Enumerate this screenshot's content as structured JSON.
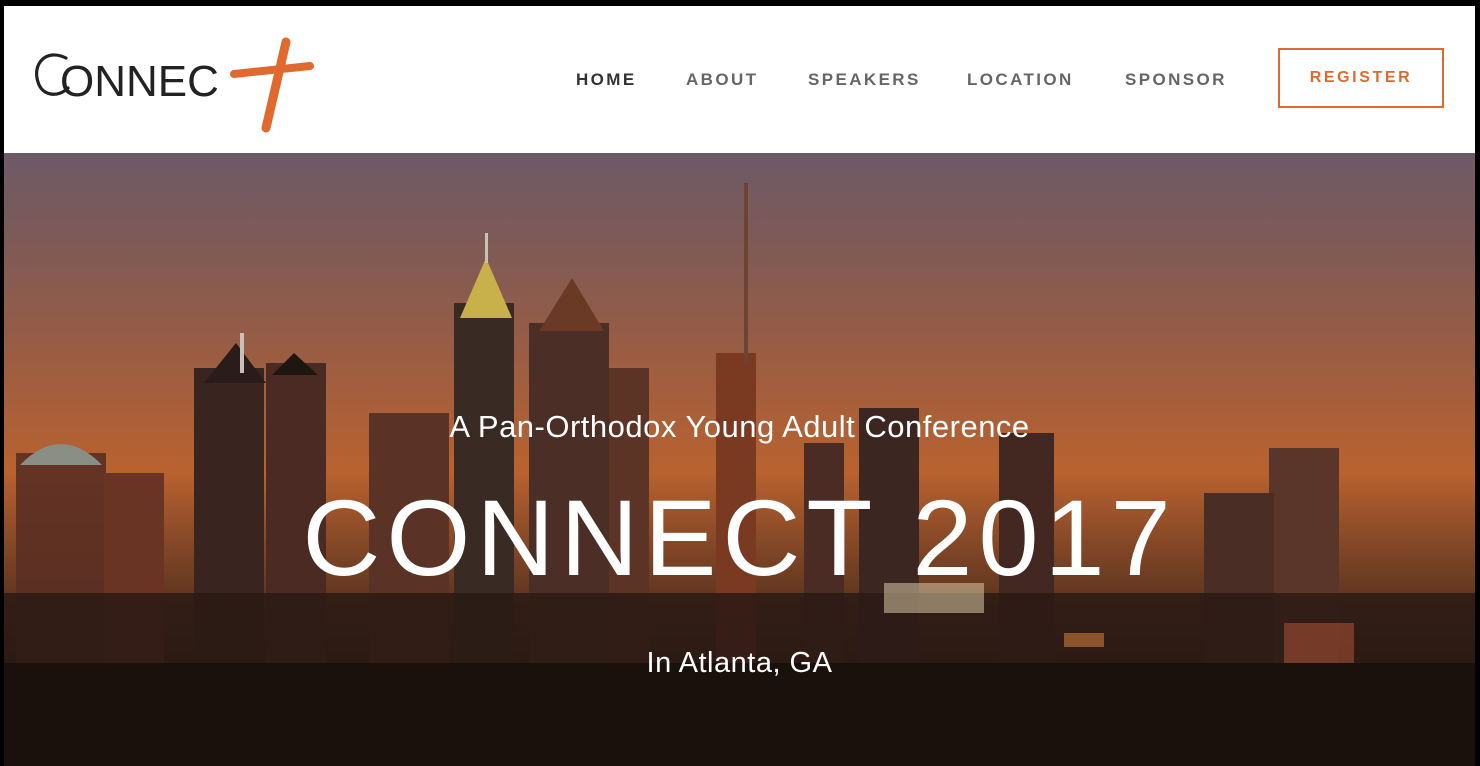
{
  "header": {
    "logo_text": "ONNEC",
    "logo_label": "Connect",
    "brand_color": "#e06a2e",
    "nav": [
      {
        "label": "HOME",
        "active": true
      },
      {
        "label": "ABOUT",
        "active": false
      },
      {
        "label": "SPEAKERS",
        "active": false
      },
      {
        "label": "LOCATION",
        "active": false
      },
      {
        "label": "SPONSOR",
        "active": false
      }
    ],
    "register_label": "REGISTER"
  },
  "hero": {
    "subtitle": "A Pan-Orthodox Young Adult Conference",
    "title": "CONNECT 2017",
    "location": "In Atlanta, GA"
  }
}
